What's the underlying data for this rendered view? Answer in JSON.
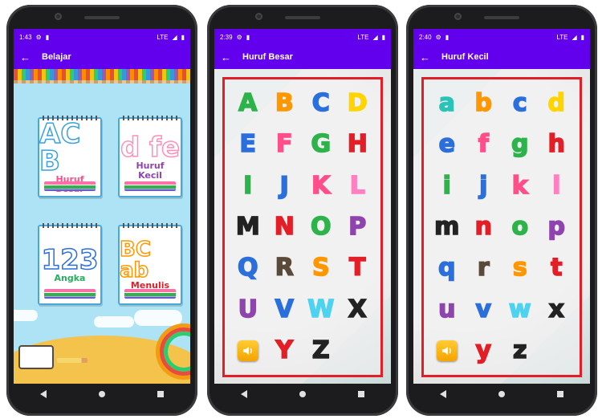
{
  "phones": [
    {
      "status": {
        "time": "1:43",
        "network": "LTE"
      },
      "appbar": {
        "title": "Belajar"
      },
      "menu": [
        {
          "big": "AC B",
          "label_lines": [
            "Huruf",
            "Besar"
          ],
          "color": "#ff4f8b"
        },
        {
          "big": "d fe",
          "label_lines": [
            "Huruf",
            "Kecil"
          ],
          "color": "#8e44ad"
        },
        {
          "big": "123",
          "label_lines": [
            "Angka"
          ],
          "color": "#27ae60"
        },
        {
          "big": "BC ab",
          "label_lines": [
            "Menulis"
          ],
          "color": "#e41e26"
        }
      ]
    },
    {
      "status": {
        "time": "2:39",
        "network": "LTE"
      },
      "appbar": {
        "title": "Huruf Besar"
      },
      "letters": [
        "A",
        "B",
        "C",
        "D",
        "E",
        "F",
        "G",
        "H",
        "I",
        "J",
        "K",
        "L",
        "M",
        "N",
        "O",
        "P",
        "Q",
        "R",
        "S",
        "T",
        "U",
        "V",
        "W",
        "X",
        "Y",
        "Z"
      ],
      "colors": [
        "#2db34a",
        "#ff9800",
        "#2a6fdb",
        "#ffd400",
        "#2a6fdb",
        "#ff4f8b",
        "#2db34a",
        "#e41e26",
        "#2db34a",
        "#2a6fdb",
        "#ff4f8b",
        "#ff80c0",
        "#222222",
        "#e41e26",
        "#2db34a",
        "#8e44ad",
        "#2a6fdb",
        "#5a4a3a",
        "#ff9800",
        "#e41e26",
        "#8e44ad",
        "#2a6fdb",
        "#4dd2f0",
        "#222222",
        "#e41e26",
        "#222222"
      ]
    },
    {
      "status": {
        "time": "2:40",
        "network": "LTE"
      },
      "appbar": {
        "title": "Huruf Kecil"
      },
      "letters": [
        "a",
        "b",
        "c",
        "d",
        "e",
        "f",
        "g",
        "h",
        "i",
        "j",
        "k",
        "l",
        "m",
        "n",
        "o",
        "p",
        "q",
        "r",
        "s",
        "t",
        "u",
        "v",
        "w",
        "x",
        "y",
        "z"
      ],
      "colors": [
        "#2ac3b8",
        "#ff9800",
        "#2a6fdb",
        "#ffd400",
        "#2a6fdb",
        "#ff4f8b",
        "#2db34a",
        "#e41e26",
        "#2db34a",
        "#2a6fdb",
        "#ff4f8b",
        "#ff80c0",
        "#222222",
        "#e41e26",
        "#2db34a",
        "#8e44ad",
        "#2a6fdb",
        "#5a4a3a",
        "#ff9800",
        "#e41e26",
        "#8e44ad",
        "#2a6fdb",
        "#4dd2f0",
        "#222222",
        "#e41e26",
        "#222222"
      ]
    }
  ],
  "icons": {
    "back": "arrow-left-icon",
    "sound": "speaker-icon"
  }
}
